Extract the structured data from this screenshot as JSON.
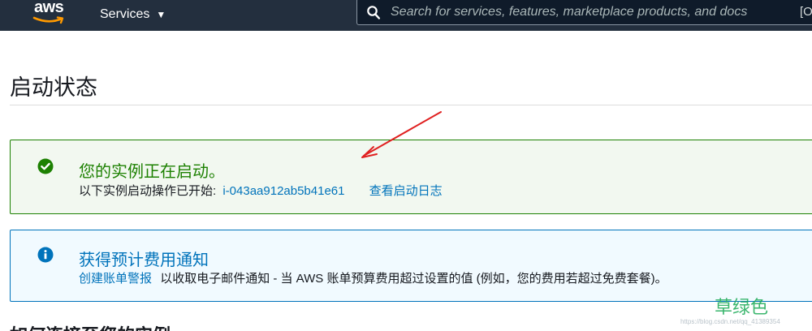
{
  "header": {
    "logo": "aws",
    "services_label": "Services",
    "services_caret": "▼",
    "search_placeholder": "Search for services, features, marketplace products, and docs",
    "shortcut": "[O"
  },
  "page": {
    "title": "启动状态"
  },
  "success_alert": {
    "heading": "您的实例正在启动。",
    "line_prefix": "以下实例启动操作已开始:",
    "instance_id": "i-043aa912ab5b41e61",
    "view_log_link": "查看启动日志",
    "icon": "check-circle-icon",
    "color": "#1d8102"
  },
  "info_alert": {
    "heading": "获得预计费用通知",
    "link": "创建账单警报",
    "text": "以收取电子邮件通知 - 当 AWS 账单预算费用超过设置的值 (例如，您的费用若超过免费套餐)。",
    "icon": "info-circle-icon",
    "color": "#0073bb"
  },
  "next_section": {
    "heading": "如何连接至您的实例"
  },
  "watermark": {
    "label": "草绿色",
    "url": "https://blog.csdn.net/qq_41389354"
  },
  "colors": {
    "nav_bg": "#232f3e",
    "link": "#0073bb",
    "annotation_arrow": "#e02020"
  }
}
